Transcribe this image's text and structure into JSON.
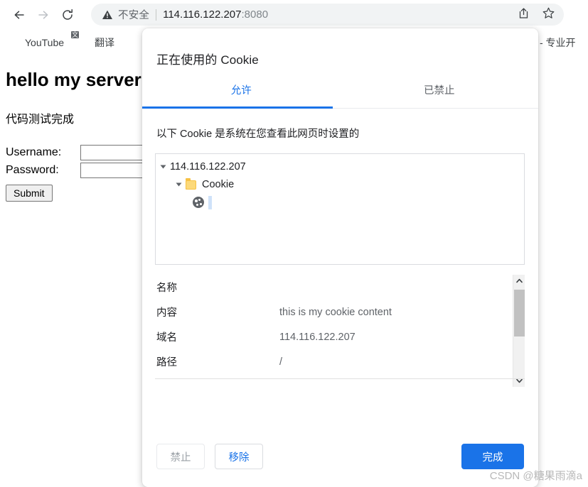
{
  "browser": {
    "nav": {
      "back_icon": "arrow-left-icon",
      "forward_icon": "arrow-right-icon",
      "reload_icon": "reload-icon"
    },
    "omnibox": {
      "warning_icon": "warning-triangle-icon",
      "warning_text": "不安全",
      "url_host": "114.116.122.207",
      "url_port": ":8080",
      "share_icon": "share-icon",
      "bookmark_star_icon": "star-icon"
    },
    "bookmarks": [
      {
        "label": "YouTube",
        "icon": "youtube-icon"
      },
      {
        "label": "翻译",
        "icon": "google-translate-icon"
      }
    ],
    "bookmark_clipped": "N - 专业开"
  },
  "page": {
    "heading": "hello my server!",
    "paragraph": "代码测试完成",
    "form": {
      "username_label": "Username:",
      "username_value": "",
      "password_label": "Password:",
      "password_value": "",
      "submit_label": "Submit"
    }
  },
  "dialog": {
    "title": "正在使用的 Cookie",
    "tabs": [
      {
        "label": "允许",
        "active": true
      },
      {
        "label": "已禁止",
        "active": false
      }
    ],
    "description": "以下 Cookie 是系统在您查看此网页时设置的",
    "tree": {
      "root": {
        "label": "114.116.122.207",
        "expander_icon": "triangle-down-icon"
      },
      "folder": {
        "label": "Cookie",
        "expander_icon": "triangle-down-icon",
        "icon": "folder-icon"
      },
      "leaf": {
        "label": "",
        "icon": "cookie-icon",
        "selected": true
      }
    },
    "details": [
      {
        "label": "名称",
        "value": ""
      },
      {
        "label": "内容",
        "value": "this is my cookie content"
      },
      {
        "label": "域名",
        "value": "114.116.122.207"
      },
      {
        "label": "路径",
        "value": "/"
      }
    ],
    "scrollbar": {
      "up_icon": "chevron-up-icon",
      "down_icon": "chevron-down-icon"
    },
    "buttons": {
      "block": "禁止",
      "remove": "移除",
      "done": "完成"
    },
    "accent_color": "#1a73e8"
  },
  "watermark": "CSDN @糖果雨滴a"
}
